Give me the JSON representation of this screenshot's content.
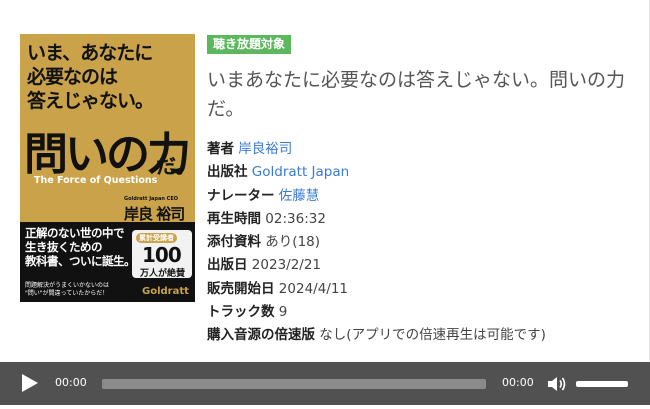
{
  "badge": "聴き放題対象",
  "title": "いまあなたに必要なのは答えじゃない。問いの力だ。",
  "cover": {
    "line1": "いま、あなたに",
    "line2": "必要なのは",
    "line3": "答えじゃない。",
    "big": "問いの力",
    "da": "だ。",
    "english": "The Force of Questions",
    "ceo": "Goldratt Japan CEO",
    "author": "岸良 裕司",
    "dark_text": "正解のない世の中で\n生き抜くための\n教科書、ついに誕生。",
    "small_text": "問題解決がうまくいかないのは\n\"問い\"が間違っていたからだ！",
    "badge_top": "累計受講者",
    "badge_num": "100",
    "badge_unit": "万人が絶賛",
    "brand": "Goldratt"
  },
  "details": [
    {
      "label": "著者",
      "value": "岸良裕司",
      "link": true
    },
    {
      "label": "出版社",
      "value": "Goldratt Japan",
      "link": true
    },
    {
      "label": "ナレーター",
      "value": "佐藤慧",
      "link": true
    },
    {
      "label": "再生時間",
      "value": "02:36:32",
      "link": false
    },
    {
      "label": "添付資料",
      "value": "あり(18)",
      "link": false
    },
    {
      "label": "出版日",
      "value": "2023/2/21",
      "link": false
    },
    {
      "label": "販売開始日",
      "value": "2024/4/11",
      "link": false
    },
    {
      "label": "トラック数",
      "value": "9",
      "link": false
    },
    {
      "label": "購入音源の倍速版",
      "value": "なし(アプリでの倍速再生は可能です)",
      "link": false
    }
  ],
  "player": {
    "current_time": "00:00",
    "duration": "00:00",
    "progress": 0,
    "volume": 1.0
  },
  "colors": {
    "badge_bg": "#5cb85c",
    "link": "#3a7bd5",
    "player_bg": "#515151",
    "cover_gold": "#c9a24a"
  }
}
